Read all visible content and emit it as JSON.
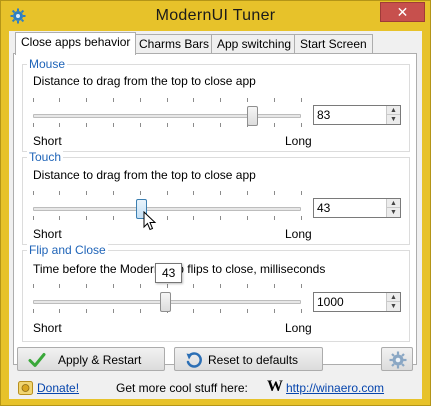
{
  "window": {
    "title": "ModernUI Tuner",
    "close_glyph": "✕",
    "accent_color": "#e7c22a",
    "close_color": "#c7504d"
  },
  "tabs": [
    {
      "label": "Close apps behavior",
      "active": true
    },
    {
      "label": "Charms Bars",
      "active": false
    },
    {
      "label": "App switching",
      "active": false
    },
    {
      "label": "Start Screen",
      "active": false
    }
  ],
  "groups": {
    "mouse": {
      "title": "Mouse",
      "description": "Distance to drag from the top to close app",
      "value": "83",
      "slider_fraction": 0.88,
      "min_label": "Short",
      "max_label": "Long"
    },
    "touch": {
      "title": "Touch",
      "description": "Distance to drag from the top to close app",
      "value": "43",
      "slider_fraction": 0.42,
      "min_label": "Short",
      "max_label": "Long",
      "tooltip": "43"
    },
    "flip": {
      "title": "Flip and Close",
      "description": "Time before the Modern app flips to close, milliseconds",
      "value": "1000",
      "slider_fraction": 0.5,
      "min_label": "Short",
      "max_label": "Long"
    }
  },
  "buttons": {
    "apply": "Apply & Restart",
    "reset": "Reset to defaults"
  },
  "footer": {
    "donate": "Donate!",
    "promo": "Get more cool stuff here:",
    "site_logo": "W",
    "site_link": "http://winaero.com"
  }
}
